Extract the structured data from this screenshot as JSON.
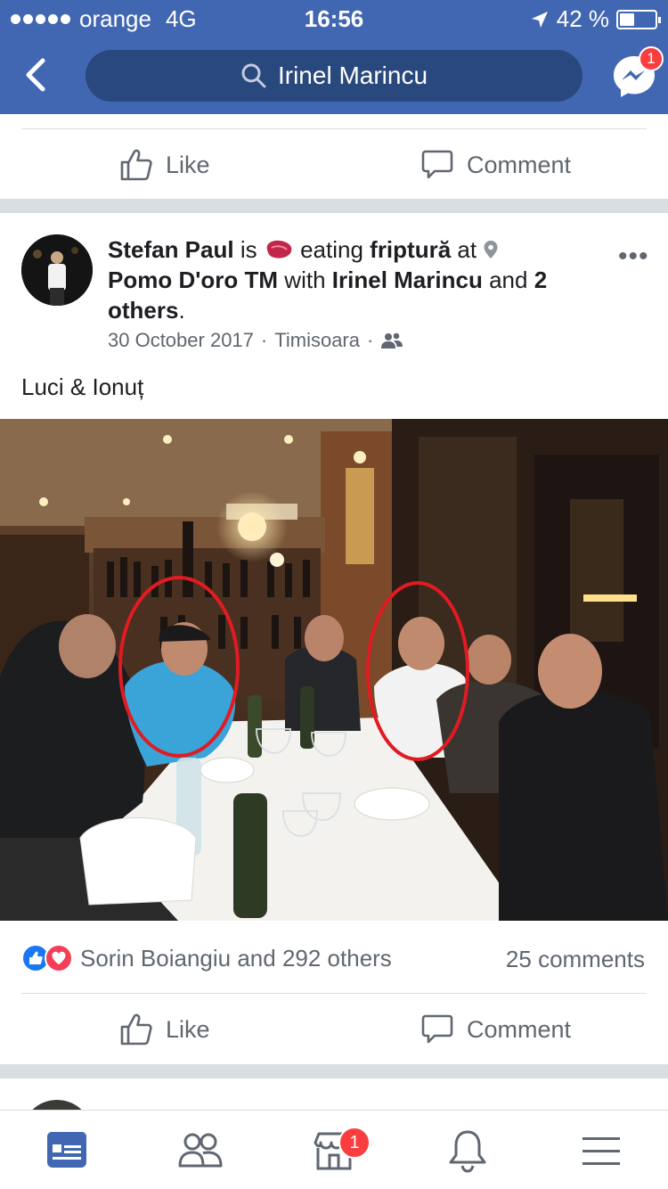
{
  "status_bar": {
    "carrier": "orange",
    "network": "4G",
    "time": "16:56",
    "battery": "42 %"
  },
  "header": {
    "search_text": "Irinel Marincu",
    "messenger_badge": "1"
  },
  "previous_post": {
    "like_label": "Like",
    "comment_label": "Comment"
  },
  "post": {
    "author": "Stefan Paul",
    "is_word": "is",
    "activity_verb": "eating",
    "activity_object": "friptură",
    "at_word": "at",
    "place": "Pomo D'oro TM",
    "with_word": "with",
    "tagged": "Irinel Marincu",
    "and_word": "and",
    "others": "2 others",
    "period": ".",
    "date": "30 October 2017",
    "location": "Timisoara",
    "separator": "·",
    "caption": "Luci & Ionuț",
    "reactions_text": "Sorin Boiangiu and 292 others",
    "comments_count": "25 comments",
    "like_label": "Like",
    "comment_label": "Comment"
  },
  "bottom_nav": {
    "marketplace_badge": "1",
    "active_tab": "news-feed"
  },
  "colors": {
    "brand": "#4267b2",
    "search_bg": "#29487d",
    "badge": "#fa3e3e",
    "annotation": "#e11b22"
  }
}
